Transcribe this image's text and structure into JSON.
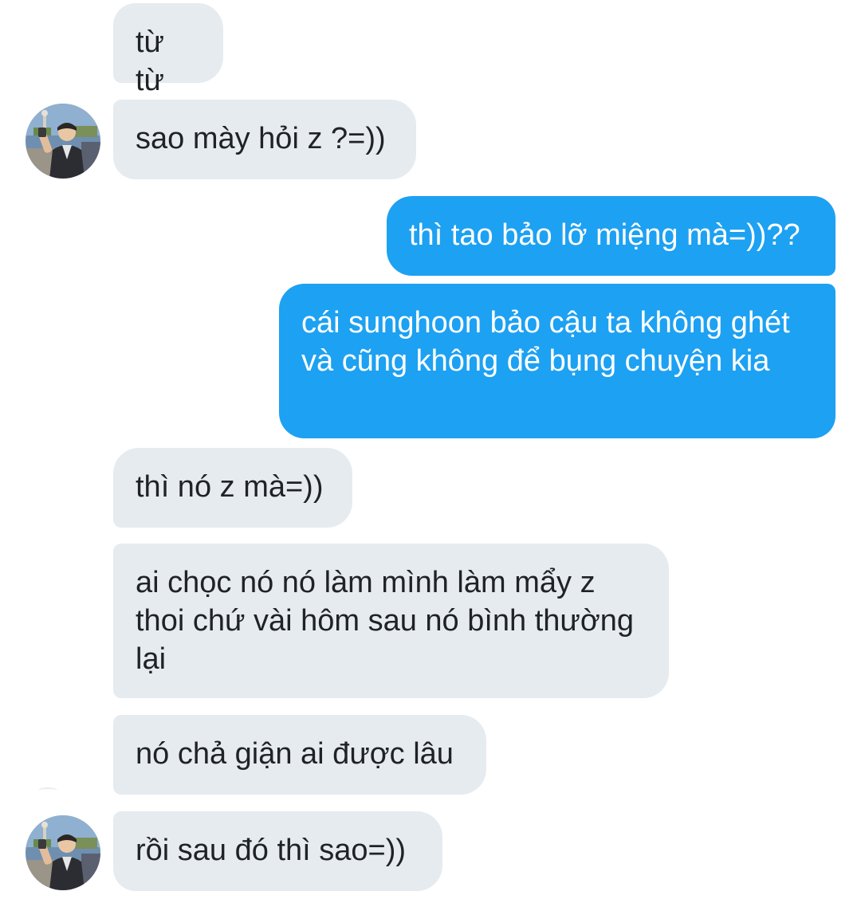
{
  "conversation": {
    "messages": [
      {
        "direction": "incoming",
        "text": "từ từ"
      },
      {
        "direction": "incoming",
        "text": "sao mày hỏi z ?=))"
      },
      {
        "direction": "outgoing",
        "text": "thì tao bảo lỡ miệng mà=))??"
      },
      {
        "direction": "outgoing",
        "text": "cái sunghoon bảo cậu ta không ghét và cũng không để bụng chuyện kia"
      },
      {
        "direction": "incoming",
        "text": "thì nó z mà=))"
      },
      {
        "direction": "incoming",
        "text": "ai chọc nó nó làm mình làm mẩy z thoi chứ vài hôm sau nó bình thường lại"
      },
      {
        "direction": "incoming",
        "text": "nó chả giận ai được lâu"
      },
      {
        "direction": "incoming",
        "text": "rồi sau đó thì sao=))"
      }
    ]
  },
  "colors": {
    "incoming_bubble": "#e6ebef",
    "outgoing_bubble": "#1da1f2",
    "incoming_text": "#1f2328",
    "outgoing_text": "#ffffff"
  },
  "icons": {
    "contact_avatar": "avatar-photo"
  }
}
